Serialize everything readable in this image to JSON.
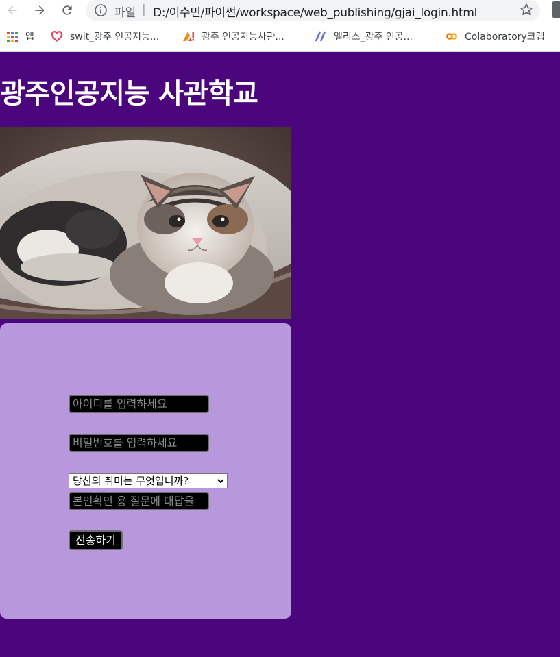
{
  "browser": {
    "scheme_label": "파일",
    "separator": "|",
    "url": "D:/이수민/파이썬/workspace/web_publishing/gjai_login.html",
    "bookmarks": [
      {
        "label": "앱",
        "icon": "apps-grid-icon"
      },
      {
        "label": "swit_광주 인공지능...",
        "icon": "swit-heart-icon"
      },
      {
        "label": "광주 인공지능사관...",
        "icon": "ai-school-icon"
      },
      {
        "label": "앨리스_광주 인공...",
        "icon": "elice-slash-icon"
      },
      {
        "label": "Colaboratory코랩",
        "icon": "colab-icon"
      }
    ]
  },
  "page": {
    "title": "광주인공지능 사관학교",
    "image_subject": "kitten-photo"
  },
  "form": {
    "id_placeholder": "아이디를 입력하세요",
    "password_placeholder": "비밀번호를 입력하세요",
    "question_selected": "당신의 취미는 무엇입니까?",
    "answer_placeholder": "본인확인 용 질문에 대답을",
    "submit_label": "전송하기"
  },
  "colors": {
    "page_background": "#4b067d",
    "panel_background": "#b898dc",
    "field_background": "#000000"
  }
}
